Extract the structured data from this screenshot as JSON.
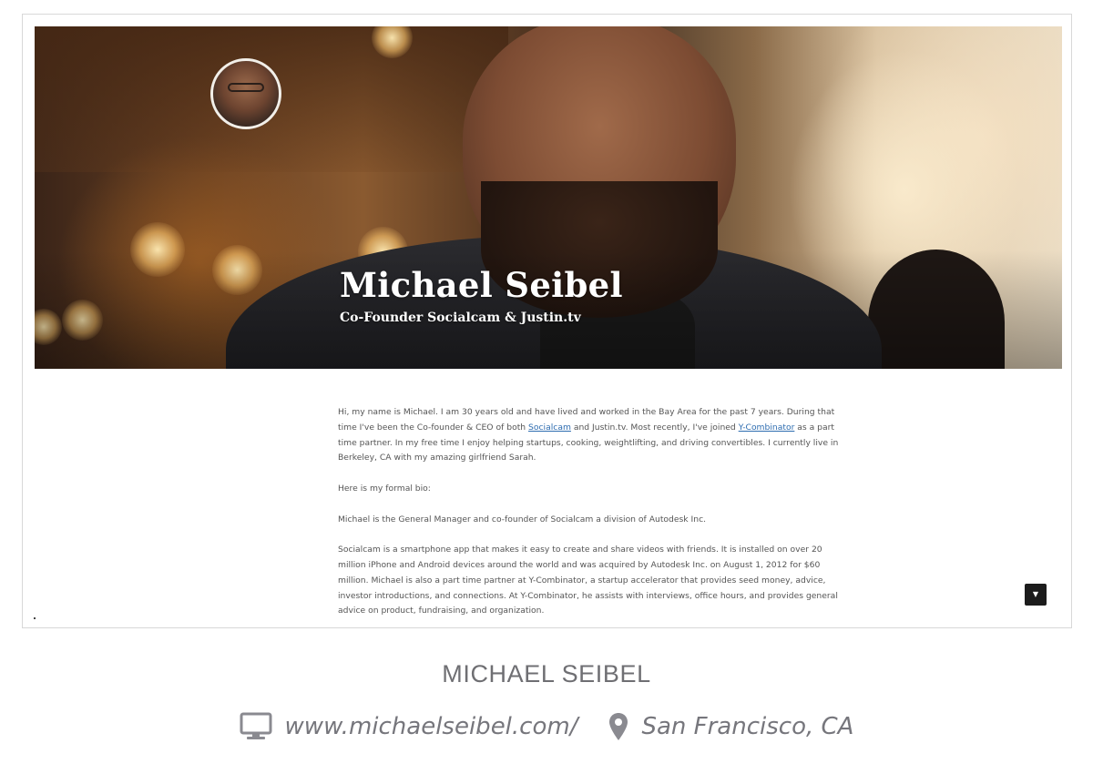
{
  "profile_preview": {
    "hero_name": "Michael Seibel",
    "hero_subtitle": "Co-Founder Socialcam & Justin.tv",
    "bio": {
      "p1_a": "Hi, my name is Michael. I am 30 years old and have lived and worked in the Bay Area for the past 7 years. During that time I've been the Co-founder & CEO of both ",
      "link_socialcam": "Socialcam",
      "p1_b": " and Justin.tv. Most recently, I've joined ",
      "link_ycombinator": "Y-Combinator",
      "p1_c": " as a part time partner. In my free time I enjoy helping startups, cooking, weightlifting, and driving convertibles. I currently live in Berkeley, CA with my amazing girlfriend Sarah.",
      "p2": "Here is my formal bio:",
      "p3": "Michael is the General Manager and co-founder of Socialcam a division of Autodesk Inc.",
      "p4": "Socialcam is a smartphone app that makes it easy to create and share videos with friends. It is installed on over 20 million iPhone and Android devices around the world and was acquired by Autodesk Inc. on August 1, 2012 for $60 million. Michael is also a part time partner at Y-Combinator, a startup accelerator that provides seed money, advice, investor introductions, and connections. At Y-Combinator, he assists with interviews, office hours, and provides general advice on product, fundraising, and organization."
    }
  },
  "caption": {
    "name": "MICHAEL SEIBEL",
    "website": "www.michaelseibel.com/",
    "location": "San Francisco, CA"
  },
  "icons": {
    "website": "monitor-icon",
    "location": "map-pin-icon",
    "scroll": "caret-down-icon"
  },
  "colors": {
    "link": "#2d6cb0",
    "caption_text": "#6f6f73",
    "meta_text": "#76767c"
  }
}
